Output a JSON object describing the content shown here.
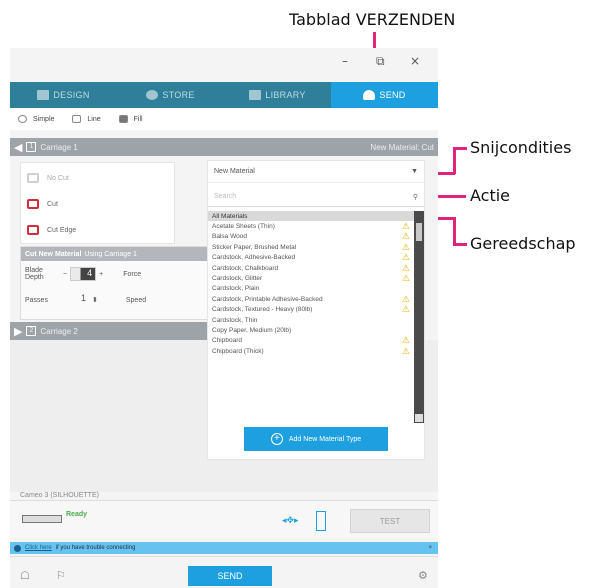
{
  "annotations": {
    "send_tab": "Tabblad VERZENDEN",
    "cut_conditions": "Snijcondities",
    "action": "Actie",
    "tool": "Gereedschap"
  },
  "window_controls": {
    "minimize": "–",
    "maximize": "⧉",
    "close": "×"
  },
  "nav_tabs": [
    {
      "label": "DESIGN",
      "icon": "design-icon"
    },
    {
      "label": "STORE",
      "icon": "store-icon"
    },
    {
      "label": "LIBRARY",
      "icon": "library-icon"
    },
    {
      "label": "SEND",
      "icon": "send-icon",
      "active": true
    }
  ],
  "modes": [
    "Simple",
    "Line",
    "Fill"
  ],
  "carriage1": {
    "number": "1",
    "label": "Carriage 1",
    "right_label": "New Material: Cut"
  },
  "actions": [
    "No Cut",
    "Cut",
    "Cut Edge"
  ],
  "cut_panel": {
    "heading_bold": "Cut New Material",
    "heading_rest": "Using Carriage 1",
    "blade_label": "Blade Depth",
    "blade_value": "4",
    "force_label": "Force",
    "passes_label": "Passes",
    "passes_value": "1",
    "speed_label": "Speed"
  },
  "material": {
    "selected": "New Material",
    "search_placeholder": "Search",
    "header": "All Materials",
    "items": [
      {
        "name": "Acetate Sheets (Thin)",
        "warn": true
      },
      {
        "name": "Balsa Wood",
        "warn": true
      },
      {
        "name": "Sticker Paper, Brushed Metal",
        "warn": true
      },
      {
        "name": "Cardstock, Adhesive-Backed",
        "warn": true
      },
      {
        "name": "Cardstock, Chalkboard",
        "warn": true
      },
      {
        "name": "Cardstock, Glitter",
        "warn": true
      },
      {
        "name": "Cardstock, Plain",
        "warn": false
      },
      {
        "name": "Cardstock, Printable Adhesive-Backed",
        "warn": true
      },
      {
        "name": "Cardstock, Textured - Heavy (80lb)",
        "warn": true
      },
      {
        "name": "Cardstock, Thin",
        "warn": false
      },
      {
        "name": "Copy Paper, Medium (20lb)",
        "warn": false
      },
      {
        "name": "Chipboard",
        "warn": true
      },
      {
        "name": "Chipboard (Thick)",
        "warn": true
      }
    ],
    "add_button": "Add New Material Type"
  },
  "carriage2": {
    "number": "2",
    "label": "Carriage 2"
  },
  "device": {
    "label": "Cameo 3 (SILHOUETTE)",
    "status": "Ready",
    "test_button": "TEST"
  },
  "hint": {
    "link": "Click here",
    "text": "if you have trouble connecting"
  },
  "footer": {
    "send_button": "SEND"
  }
}
